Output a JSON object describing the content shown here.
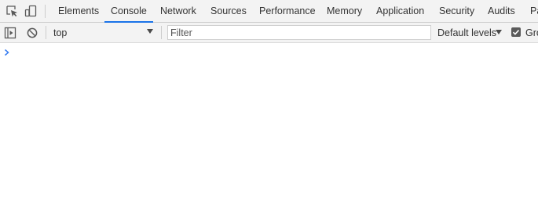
{
  "tabbar": {
    "inspect_icon": "inspect-element-icon",
    "device_icon": "device-toolbar-icon",
    "tabs": [
      {
        "label": "Elements",
        "selected": false
      },
      {
        "label": "Console",
        "selected": true
      },
      {
        "label": "Network",
        "selected": false
      },
      {
        "label": "Sources",
        "selected": false
      },
      {
        "label": "Performance",
        "selected": false
      },
      {
        "label": "Memory",
        "selected": false
      },
      {
        "label": "Application",
        "selected": false
      },
      {
        "label": "Security",
        "selected": false
      },
      {
        "label": "Audits",
        "selected": false
      },
      {
        "label": "Pa",
        "selected": false
      }
    ]
  },
  "toolbar": {
    "sidebar_icon": "show-console-sidebar-icon",
    "clear_icon": "clear-console-icon",
    "context": "top",
    "filter_placeholder": "Filter",
    "filter_value": "",
    "levels": "Default levels",
    "group_label": "Gro",
    "group_checked": true
  },
  "console": {
    "prompt_icon": "chevron-right-icon",
    "input_value": ""
  },
  "colors": {
    "accent": "#1a73e8",
    "prompt": "#367cf1",
    "toolbar_bg": "#f3f3f3"
  }
}
